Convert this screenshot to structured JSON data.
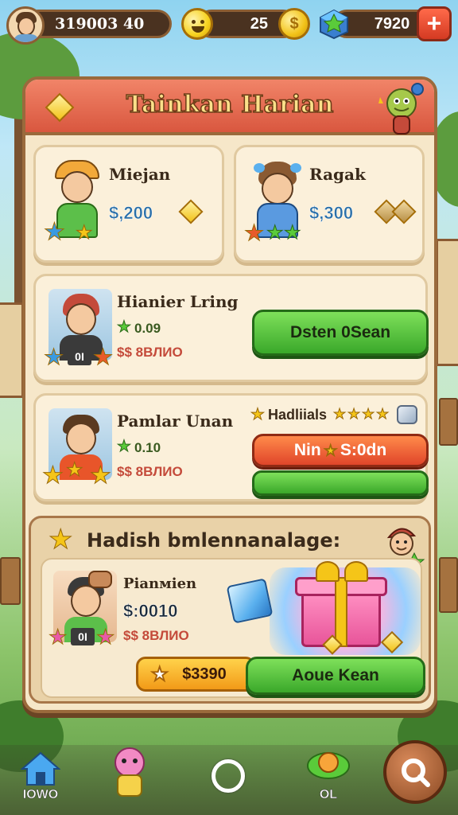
{
  "topbar": {
    "player_score": "319003   40",
    "coins": "25",
    "gems": "7920",
    "add_label": "+"
  },
  "panel": {
    "title": "Tainkan Harian"
  },
  "cards": [
    {
      "name": "Miejan",
      "price": "$,200"
    },
    {
      "name": "Ragak",
      "price": "$,300"
    }
  ],
  "wide_cards": [
    {
      "name": "Hianier Lring",
      "stat": "0.09",
      "subprice": "$$ 8BЛИО",
      "badge": "0I",
      "button": "Dsten 0Sean"
    },
    {
      "name": "Pamlar Unan",
      "stat": "0.10",
      "subprice": "$$ 8BЛИО",
      "rating_label": "Hadliials",
      "button_top": "Nin",
      "button_top_value": "S:0dn",
      "button_bottom": ""
    }
  ],
  "special": {
    "title": "Hadish bmlennanalage:",
    "name": "Pianмien",
    "price": "$:0010",
    "subprice": "$$ 8BЛИО",
    "badge": "0I",
    "price_pill": "$3390",
    "button": "Aoue Kean"
  },
  "nav": {
    "home_label": "IOWO",
    "item4_label": "ОL"
  },
  "colors": {
    "header": "#d9573f",
    "panel_bg": "#f6e7c9",
    "green_button": "#3aa82a",
    "orange_button": "#e0452a",
    "price_blue": "#2a6fa8"
  }
}
